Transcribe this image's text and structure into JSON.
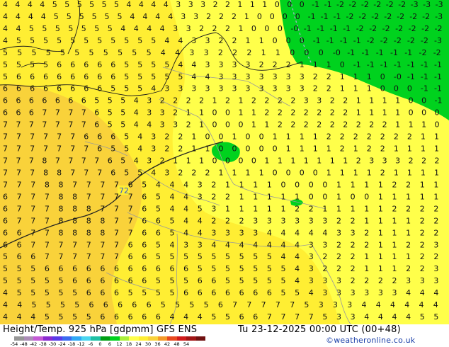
{
  "map": {
    "title": "Height/Temp. 925 hPa [gdpmm] GFS ENS",
    "valid": "Tu 23-12-2025 00:00 UTC (00+48)",
    "credit": "©weatheronline.co.uk",
    "contour_label": "72",
    "colors": {
      "background_yellow": "#ffee33",
      "orange_yellow": "#f9d23a",
      "green": "#00d21e",
      "light_yellow": "#ffff4a"
    },
    "colorbar": {
      "labels": [
        "-54",
        "-48",
        "-42",
        "-38",
        "-30",
        "-24",
        "-18",
        "-12",
        "-6",
        "0",
        "6",
        "12",
        "18",
        "24",
        "30",
        "36",
        "42",
        "48",
        "54"
      ],
      "colors": [
        "#969696",
        "#ab8cb6",
        "#c45ad5",
        "#8b2bd0",
        "#5a3be8",
        "#3a6af0",
        "#2fa8f5",
        "#4ad6f0",
        "#1fc1a5",
        "#00a014",
        "#00d21e",
        "#aaf03a",
        "#ffff4a",
        "#ffee33",
        "#f9d23a",
        "#f59a28",
        "#e8491e",
        "#d01a1a",
        "#a01414",
        "#701010"
      ]
    },
    "rows": [
      "4 4 4 4 5 5 5 5 5 5 4 4 4 4 3 3 3 2 2 1 1 1 0 0 0 -1 -1 -2 -2 -2 -2 -2 -2 -3 -3 -3",
      "4 4 4 4 5 5 5 5 5 5 4 4 4 4 3 3 2 2 2 1 0 0 0 0 -1 -1 -1 -2 -2 -2 -2 -2 -2 -2 -3",
      "4 4 5 5 5 5 5 5 5 4 4 4 4 3 3 2 2 2 1 0 0 0 -0 -1 -1 -1 -1 -2 -2 -2 -2 -2 -2 -2",
      "4 5 5 5 5 5 5 5 5 5 5 5 4 4 3 3 2 2 1 1 0 0 0 -1 -1 -1 -1 -2 -2 -2 -2 -2 -3",
      "5 5 5 5 5 5 5 5 5 5 5 4 4 3 3 2 2 2 1 1 0 0 0 -0 -1 -1 -1 -1 -1 -2 -2",
      "5 5 5 5 6 6 6 6 6 5 5 5 5 4 4 3 3 3 3 2 2 2 1 1 1 0 -1 -1 -1 -1 -1 -1 -1",
      "5 6 6 6 6 6 6 6 6 5 5 5 5 5 4 4 3 3 3 3 3 3 3 2 2 1 1 1 0 -0 -1 -1 -1",
      "6 6 6 6 6 6 6 6 5 5 5 4 3 3 3 3 3 3 3 3 3 3 3 2 2 1 1 1 0 0 0 -1 -1",
      "6 6 6 6 6 6 6 5 5 5 4 3 2 2 2 2 1 2 1 2 2 2 2 3 3 2 2 1 1 1 1 0 0 -1",
      "6 6 6 7 7 7 7 6 5 5 4 3 3 2 1 1 0 0 1 1 2 2 2 2 2 2 2 1 1 1 1 0 0 0",
      "7 7 7 7 7 7 7 6 5 5 4 4 3 3 2 1 0 0 0 1 1 2 2 2 2 2 2 2 2 2 1 1 1 0",
      "7 7 7 7 7 7 6 6 6 5 4 3 2 2 1 0 0 1 0 0 1 1 1 1 2 2 2 2 2 2 2 1 1",
      "7 7 7 7 7 7 7 6 5 5 4 3 2 2 1 1 0 0 0 0 0 1 1 1 1 2 1 2 2 1 1 1 1",
      "7 7 7 8 7 7 7 7 6 5 4 3 2 1 1 1 0 0 0 0 1 1 1 1 1 1 1 2 3 3 3 2 2 2",
      "7 7 7 8 8 7 7 7 6 5 5 4 3 2 2 2 1 1 1 1 0 0 0 0 1 1 1 1 2 1 1 1 1",
      "7 7 7 8 8 7 7 7 7 6 5 4 4 4 3 2 1 1 1 1 0 0 0 0 1 1 1 1 2 2 1 1",
      "6 7 7 7 8 8 7 7 7 7 6 5 4 4 3 2 2 1 1 1 1 1 0 0 1 0 0 1 1 1 1 1",
      "6 7 7 7 8 8 8 7 7 7 6 5 4 4 5 3 1 1 1 1 1 2 2 1 1 1 1 1 2 2 2 2",
      "6 7 7 7 8 8 8 8 7 7 6 6 5 4 4 2 2 2 3 3 3 3 3 3 2 2 1 1 1 1 2 2",
      "6 6 7 7 8 8 8 8 7 7 6 6 5 4 4 3 3 3 3 4 4 4 4 4 3 3 2 1 1 1 2 2",
      "6 6 7 7 7 7 7 7 7 6 6 5 4 3 3 4 4 4 4 4 4 4 3 3 2 2 2 1 1 2 2 3",
      "5 6 6 7 7 7 7 7 7 6 6 5 5 5 5 5 5 5 5 5 4 4 3 2 2 2 1 1 1 1 2 2",
      "5 5 5 6 6 6 6 6 6 6 6 6 6 6 5 5 5 5 5 5 5 4 3 2 2 2 1 1 1 2 2 3",
      "5 5 5 5 5 6 6 6 6 6 6 5 5 5 6 6 5 5 5 5 5 4 3 3 3 2 2 2 2 3 3 3",
      "4 5 5 5 5 5 6 6 6 5 5 5 5 6 6 6 6 6 6 6 5 5 4 3 3 3 3 3 3 4 4 4",
      "4 4 5 5 5 5 6 6 6 6 6 5 5 5 5 6 7 7 7 7 7 5 3 3 3 4 4 4 4 4 4",
      "4 4 4 5 5 5 5 6 6 6 6 6 4 4 4 5 5 6 6 7 7 7 7 5 3 3 4 4 4 4 5 5"
    ]
  }
}
